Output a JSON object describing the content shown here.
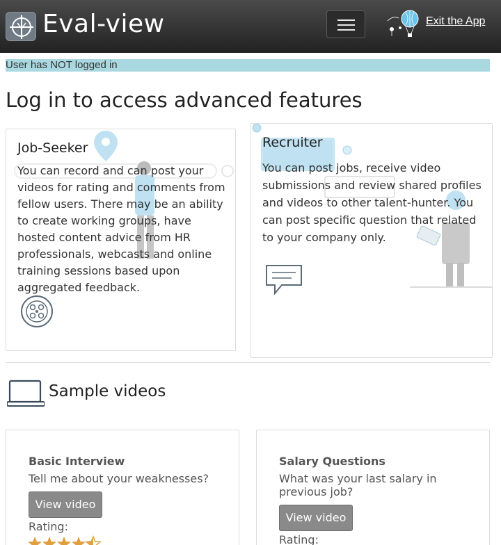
{
  "header": {
    "brand": "Eval-view",
    "exit_label": " Exit the App",
    "logo_icon": "crosshair-logo-icon",
    "menu_icon": "hamburger-menu-icon",
    "balloon_icon": "hot-air-balloon-icon"
  },
  "status": {
    "text": "User has NOT logged in",
    "color": "#aad8e0"
  },
  "page": {
    "title": "Log in to access advanced features"
  },
  "cards": {
    "seeker": {
      "title": "Job-Seeker",
      "body": "You can record and can post your videos for rating and comments from fellow users. There may be an ability to create working groups, have hosted content advice from HR professionals, webcasts and online training sessions based upon aggregated feedback."
    },
    "recruiter": {
      "title": "Recruiter",
      "body": "You can post jobs, receive video submissions and review shared profiles and videos to other talent-hunter. You can post specific question that related to your company only."
    }
  },
  "samples": {
    "title": "Sample videos",
    "videos": [
      {
        "title": "Basic Interview",
        "question": "Tell me about your weaknesses?",
        "button": "View video",
        "rating_label": "Rating:",
        "rating": 4.5
      },
      {
        "title": "Salary Questions",
        "question": "What was your last salary in previous job?",
        "button": "View video",
        "rating_label": "Rating:"
      }
    ]
  },
  "colors": {
    "navbar": "#333333",
    "status_bg": "#aad8e0",
    "button": "#8a8a8a",
    "star": "#e0a040"
  }
}
